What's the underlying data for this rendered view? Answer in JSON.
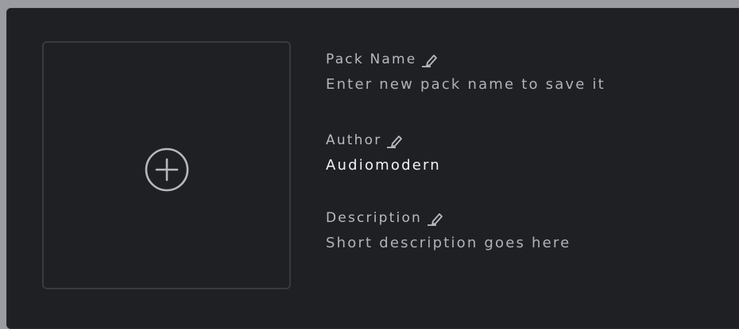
{
  "image_slot": {
    "icon": "plus-circle-icon"
  },
  "fields": {
    "pack_name": {
      "label": "Pack Name",
      "placeholder": "Enter new pack name to save it",
      "value": ""
    },
    "author": {
      "label": "Author",
      "value": "Audiomodern"
    },
    "description": {
      "label": "Description",
      "placeholder": "Short description goes here",
      "value": ""
    }
  },
  "colors": {
    "panel_bg": "#1f2024",
    "label": "#b8bac0",
    "value": "#f2f3f5",
    "border": "#383a40"
  },
  "edit_icon": "pencil-icon"
}
